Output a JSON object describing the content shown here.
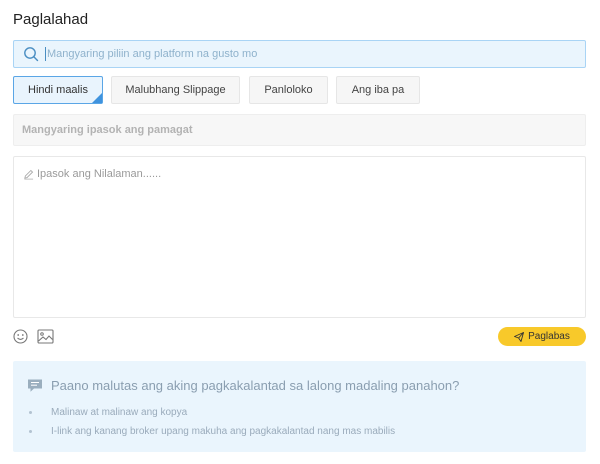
{
  "page": {
    "title": "Paglalahad"
  },
  "search": {
    "placeholder": "Mangyaring piliin ang platform na gusto mo",
    "icon": "search-icon"
  },
  "categories": [
    {
      "label": "Hindi maalis",
      "selected": true
    },
    {
      "label": "Malubhang Slippage",
      "selected": false
    },
    {
      "label": "Panloloko",
      "selected": false
    },
    {
      "label": "Ang iba pa",
      "selected": false
    }
  ],
  "form": {
    "title_placeholder": "Mangyaring ipasok ang pamagat",
    "content_placeholder": "Ipasok ang Nilalaman......",
    "publish_label": "Paglabas"
  },
  "toolbar": {
    "icons": [
      "emoji-icon",
      "image-icon"
    ]
  },
  "help": {
    "title": "Paano malutas ang aking pagkakalantad sa lalong madaling panahon?",
    "tips": [
      "Malinaw at malinaw ang kopya",
      "I-link ang kanang broker upang makuha ang pagkakalantad nang mas mabilis"
    ]
  },
  "colors": {
    "accent": "#f8c92a",
    "selected_blue": "#3f93de",
    "help_bg": "#eaf5fd"
  }
}
